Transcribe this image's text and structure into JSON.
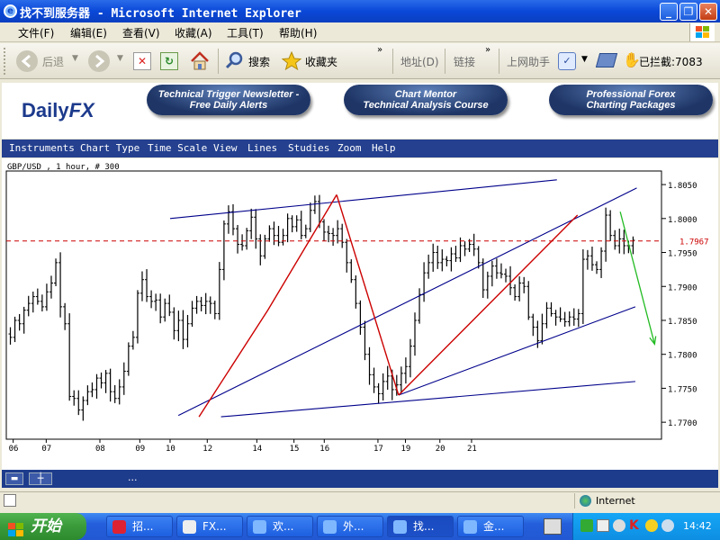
{
  "window": {
    "title": "找不到服务器 - Microsoft Internet Explorer",
    "min_label": "_",
    "max_label": "❐",
    "close_label": "✕"
  },
  "menu": [
    "文件(F)",
    "编辑(E)",
    "查看(V)",
    "收藏(A)",
    "工具(T)",
    "帮助(H)"
  ],
  "toolbar": {
    "back_label": "后退",
    "search_label": "搜索",
    "favorites_label": "收藏夹",
    "address_label": "地址(D)",
    "links_label": "链接",
    "assistant_label": "上网助手",
    "blocked_label": "已拦截:7083"
  },
  "banner": {
    "logo_main": "Daily",
    "logo_fx": "FX",
    "pills": [
      {
        "line1": "Technical Trigger Newsletter -",
        "line2": "Free Daily Alerts"
      },
      {
        "line1": "Chart Mentor",
        "line2": "Technical Analysis Course"
      },
      {
        "line1": "Professional Forex",
        "line2": "Charting Packages"
      }
    ]
  },
  "chart_menu": [
    "Instruments",
    "Chart Type",
    "Time Scale",
    "View",
    "Lines",
    "Studies",
    "Zoom",
    "Help"
  ],
  "chart_bottom": {
    "dots": "..."
  },
  "status": {
    "zone": "Internet"
  },
  "taskbar": {
    "start_label": "开始",
    "tasks": [
      "招...",
      "FX...",
      "欢...",
      "外...",
      "找...",
      "金..."
    ],
    "clock": "14:42"
  },
  "colors": {
    "candle": "#000000",
    "channel": "#00008b",
    "trend": "#cc0000",
    "forecast": "#22bb22",
    "current_line": "#cc0000"
  },
  "chart_data": {
    "type": "ohlc",
    "title": "GBP/USD , 1 hour, # 300",
    "x_tick_labels": [
      "06",
      "07",
      "08",
      "09",
      "10",
      "12",
      "14",
      "15",
      "16",
      "17",
      "19",
      "20",
      "21"
    ],
    "y_tick_values": [
      1.805,
      1.8,
      1.795,
      1.79,
      1.785,
      1.78,
      1.775,
      1.77
    ],
    "y_tick_labels": [
      "1.8050",
      "1.8000",
      "1.7950",
      "1.7900",
      "1.7850",
      "1.7800",
      "1.7750",
      "1.7700"
    ],
    "current_price": 1.7967,
    "current_price_label": "1.7967",
    "ylim": [
      1.7675,
      1.807
    ],
    "grid": false,
    "price_path": [
      1.783,
      1.7825,
      1.785,
      1.7845,
      1.7865,
      1.7875,
      1.7885,
      1.7878,
      1.787,
      1.7892,
      1.7905,
      1.7935,
      1.787,
      1.7845,
      1.7738,
      1.7735,
      1.7718,
      1.7732,
      1.7745,
      1.7748,
      1.7765,
      1.7758,
      1.7772,
      1.7745,
      1.7735,
      1.7752,
      1.7775,
      1.7812,
      1.7825,
      1.789,
      1.791,
      1.7885,
      1.7878,
      1.788,
      1.7855,
      1.7875,
      1.7862,
      1.7835,
      1.785,
      1.7822,
      1.7845,
      1.7868,
      1.7878,
      1.7872,
      1.7878,
      1.7875,
      1.786,
      1.7925,
      1.7992,
      1.801,
      1.7985,
      1.7962,
      1.796,
      1.7982,
      1.8002,
      1.797,
      1.7945,
      1.797,
      1.7985,
      1.7975,
      1.7965,
      1.7975,
      1.8,
      1.7988,
      1.7998,
      1.7975,
      1.7985,
      1.8012,
      1.8025,
      1.7995,
      1.798,
      1.7978,
      1.7975,
      1.7985,
      1.7965,
      1.7935,
      1.791,
      1.7875,
      1.784,
      1.78,
      1.777,
      1.7752,
      1.7742,
      1.776,
      1.7768,
      1.7748,
      1.7755,
      1.7772,
      1.7782,
      1.7812,
      1.785,
      1.7888,
      1.792,
      1.7935,
      1.795,
      1.7935,
      1.794,
      1.7938,
      1.7948,
      1.7942,
      1.796,
      1.7955,
      1.7962,
      1.7955,
      1.7935,
      1.7895,
      1.7915,
      1.793,
      1.792,
      1.7918,
      1.7915,
      1.7898,
      1.7885,
      1.7905,
      1.79,
      1.7855,
      1.784,
      1.782,
      1.7845,
      1.7868,
      1.786,
      1.7855,
      1.7852,
      1.7848,
      1.7855,
      1.7852,
      1.786,
      1.794,
      1.7945,
      1.7932,
      1.7925,
      1.7952,
      1.8005,
      1.7975,
      1.796,
      1.797,
      1.796,
      1.796,
      1.7968
    ],
    "forecast": {
      "from": [
        22.3,
        1.801
      ],
      "to": [
        23.55,
        1.7815
      ]
    },
    "trend_lines": [
      [
        [
          7.0,
          1.7708
        ],
        [
          9.5,
          1.7865
        ],
        [
          12.0,
          1.8035
        ]
      ],
      [
        [
          12.0,
          1.8035
        ],
        [
          14.25,
          1.774
        ]
      ],
      [
        [
          14.25,
          1.774
        ],
        [
          20.75,
          1.8005
        ]
      ]
    ],
    "channel_lines": [
      [
        [
          5.95,
          1.8
        ],
        [
          20.0,
          1.8057
        ]
      ],
      [
        [
          6.25,
          1.771
        ],
        [
          22.9,
          1.8045
        ]
      ],
      [
        [
          7.8,
          1.7708
        ],
        [
          22.85,
          1.776
        ]
      ],
      [
        [
          14.25,
          1.774
        ],
        [
          22.85,
          1.787
        ]
      ]
    ]
  }
}
